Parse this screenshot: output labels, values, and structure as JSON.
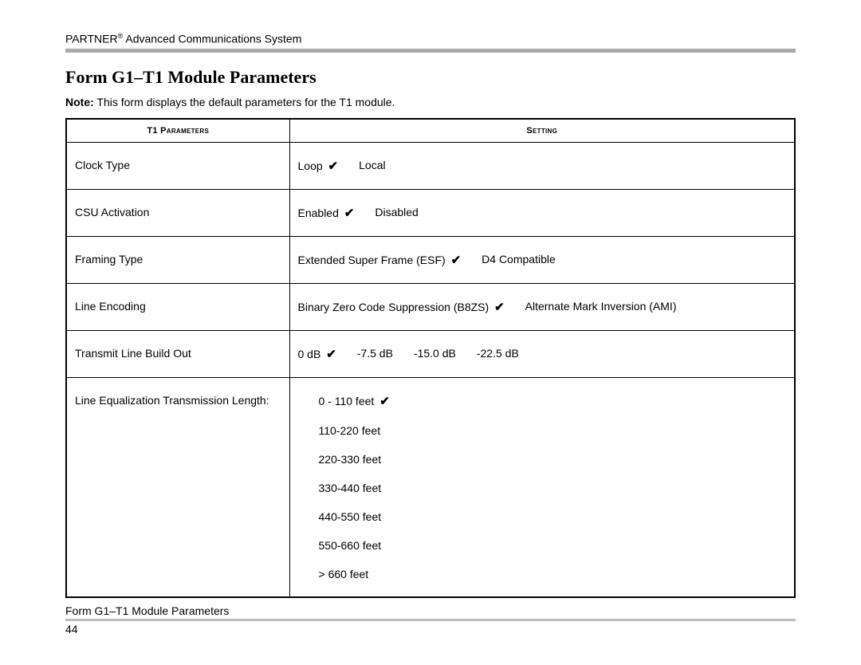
{
  "header_prefix": "PARTNER",
  "header_reg": "®",
  "header_suffix": " Advanced Communications System",
  "title": "Form G1–T1 Module Parameters",
  "note_label": "Note:",
  "note_text": " This form displays the default parameters for the T1 module.",
  "col_param": "T1 Parameters",
  "col_setting": "Setting",
  "check": "✔",
  "rows": {
    "clock": {
      "label": "Clock Type",
      "o1": "Loop",
      "o2": "Local"
    },
    "csu": {
      "label": "CSU Activation",
      "o1": "Enabled",
      "o2": "Disabled"
    },
    "framing": {
      "label": "Framing Type",
      "o1": "Extended Super Frame (ESF)",
      "o2": "D4 Compatible"
    },
    "encoding": {
      "label": "Line Encoding",
      "o1": "Binary Zero Code Suppression (B8ZS)",
      "o2": "Alternate Mark Inversion (AMI)"
    },
    "tlbo": {
      "label": "Transmit Line Build Out",
      "o1": "0 dB",
      "o2": "-7.5 dB",
      "o3": "-15.0 dB",
      "o4": "-22.5 dB"
    },
    "leq": {
      "label": "Line Equalization Transmission Length:",
      "o1": "0 - 110 feet",
      "o2": "110-220 feet",
      "o3": "220-330 feet",
      "o4": "330-440 feet",
      "o5": "440-550 feet",
      "o6": "550-660 feet",
      "o7": "> 660 feet"
    }
  },
  "caption": "Form G1–T1 Module Parameters",
  "page_number": "44"
}
